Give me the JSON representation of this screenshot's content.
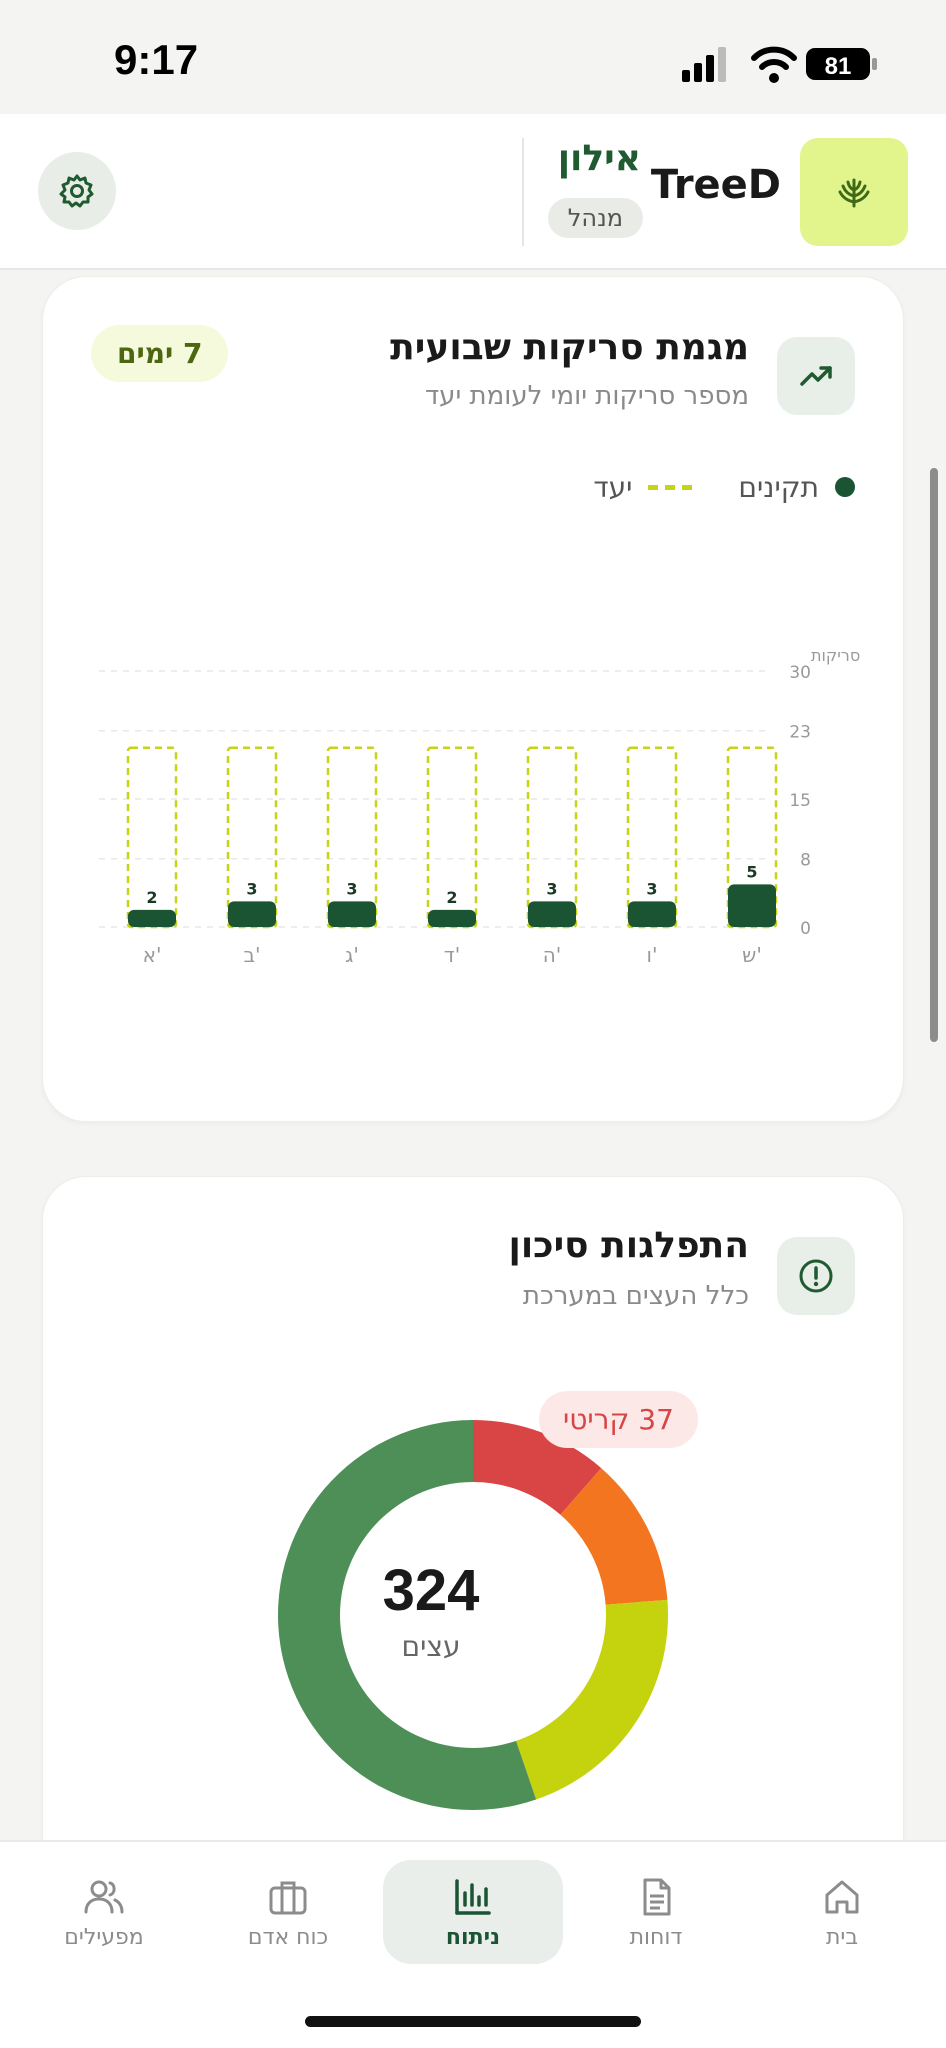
{
  "status_bar": {
    "time": "9:17",
    "battery": "81"
  },
  "header": {
    "brand": "TreeD",
    "user_name": "אילון",
    "role": "מנהל",
    "logo_icon": "tree-icon",
    "settings_icon": "gear-icon"
  },
  "weekly_card": {
    "title": "מגמת סריקות שבועית",
    "subtitle": "מספר סריקות יומי לעומת יעד",
    "badge": "7 ימים",
    "icon": "trend-up-icon",
    "legend": {
      "actual": "תקינים",
      "target": "יעד"
    }
  },
  "chart_data": {
    "type": "bar",
    "ylabel": "סריקות",
    "yticks": [
      0,
      8,
      15,
      23,
      30
    ],
    "ylim": [
      0,
      30
    ],
    "categories": [
      "ש'",
      "ו'",
      "ה'",
      "ד'",
      "ג'",
      "ב'",
      "א'"
    ],
    "series": [
      {
        "name": "תקינים",
        "values": [
          5,
          3,
          3,
          2,
          3,
          3,
          2
        ]
      },
      {
        "name": "יעד",
        "values": [
          21,
          21,
          21,
          21,
          21,
          21,
          21
        ]
      }
    ],
    "colors": {
      "actual": "#1b5432",
      "target": "#c5d418"
    },
    "grid": true
  },
  "risk_card": {
    "title": "התפלגות סיכון",
    "subtitle": "כלל העצים במערכת",
    "icon": "alert-circle-icon",
    "badge": "37 קריטי",
    "total": "324",
    "total_label": "עצים",
    "segments": [
      {
        "value": 37,
        "color": "#d94545"
      },
      {
        "value": 40,
        "color": "#f47520"
      },
      {
        "value": 68,
        "color": "#c5d20e"
      },
      {
        "value": 179,
        "color": "#4e8f57"
      }
    ]
  },
  "bottom_nav": [
    {
      "label": "בית",
      "icon": "home-icon"
    },
    {
      "label": "דוחות",
      "icon": "document-icon"
    },
    {
      "label": "ניתוח",
      "icon": "bar-chart-icon",
      "active": true
    },
    {
      "label": "כוח אדם",
      "icon": "briefcase-icon"
    },
    {
      "label": "מפעילים",
      "icon": "users-icon"
    }
  ]
}
